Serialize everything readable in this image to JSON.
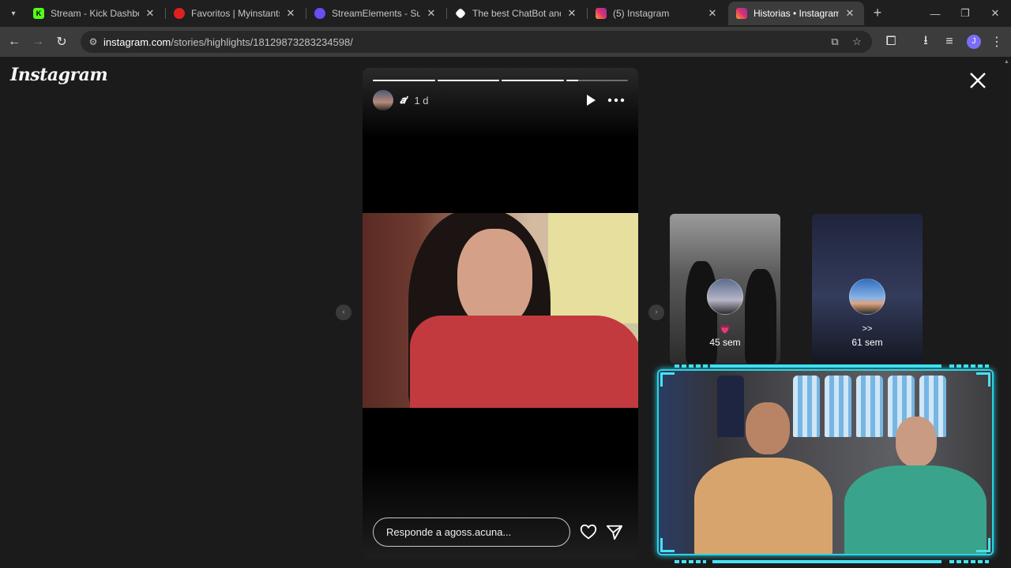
{
  "browser": {
    "tabs": [
      {
        "title": "Stream - Kick Dashboard",
        "favicon": "kick-icon",
        "color": "#53fc18",
        "letter": "K"
      },
      {
        "title": "Favoritos | Myinstants",
        "favicon": "myinstants-icon",
        "color": "#e02020",
        "letter": ""
      },
      {
        "title": "StreamElements - Superpo",
        "favicon": "streamelements-icon",
        "color": "#6b4cf5",
        "letter": ""
      },
      {
        "title": "The best ChatBot and Wid",
        "favicon": "chatbot-icon",
        "color": "#ffffff",
        "letter": ""
      },
      {
        "title": "(5) Instagram",
        "favicon": "instagram-icon",
        "color": "#e1306c",
        "letter": ""
      },
      {
        "title": "Historias • Instagram",
        "favicon": "instagram-icon",
        "color": "#e1306c",
        "letter": ""
      }
    ],
    "url_domain": "instagram.com",
    "url_path": "/stories/highlights/18129873283234598/",
    "profile_initial": "J"
  },
  "page": {
    "logo": "Instagram"
  },
  "story": {
    "username": "𝒂'",
    "time": "1 d",
    "progress": [
      1,
      1,
      1,
      0.2
    ],
    "reply_placeholder": "Responde a agoss.acuna..."
  },
  "previews": [
    {
      "title": "💗",
      "meta": "45 sem"
    },
    {
      "title": ">>",
      "meta": "61 sem"
    }
  ]
}
